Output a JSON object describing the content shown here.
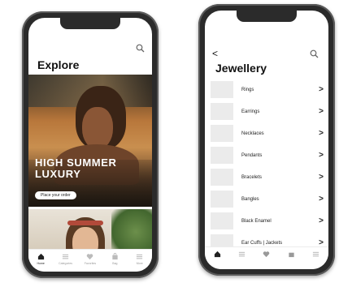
{
  "explore": {
    "title": "Explore",
    "hero_headline": "HIGH SUMMER LUXURY",
    "hero_cta": "Place your order",
    "tabs": [
      {
        "label": "Home",
        "icon": "home-icon"
      },
      {
        "label": "Categories",
        "icon": "list-icon"
      },
      {
        "label": "Favorites",
        "icon": "heart-icon"
      },
      {
        "label": "Bag",
        "icon": "bag-icon"
      },
      {
        "label": "More",
        "icon": "menu-icon"
      }
    ]
  },
  "jewellery": {
    "back_glyph": "<",
    "title": "Jewellery",
    "categories": [
      "Rings",
      "Earrings",
      "Necklaces",
      "Pendants",
      "Bracelets",
      "Bangles",
      "Black Enamel",
      "Ear Cuffs | Jackets"
    ],
    "chevron": ">"
  }
}
